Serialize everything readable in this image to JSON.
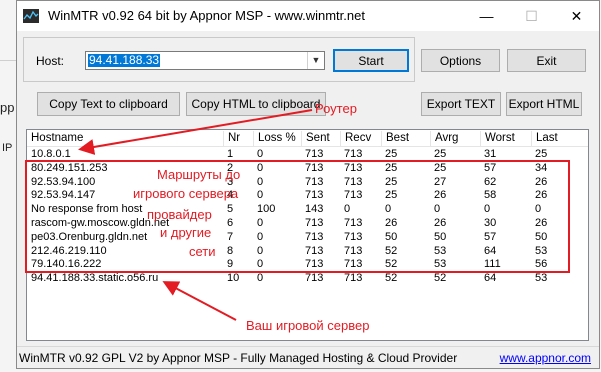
{
  "background": {
    "left_fragment": "pp",
    "ip_fragment": "IP"
  },
  "window": {
    "title": "WinMTR v0.92 64 bit by Appnor MSP - www.winmtr.net",
    "minimize": "—",
    "maximize": "☐",
    "close": "✕"
  },
  "host": {
    "label": "Host:",
    "value": "94.41.188.33"
  },
  "buttons": {
    "start": "Start",
    "options": "Options",
    "exit": "Exit",
    "copy_text": "Copy Text to clipboard",
    "copy_html": "Copy HTML to clipboard",
    "export_text": "Export TEXT",
    "export_html": "Export HTML"
  },
  "table": {
    "columns": [
      "Hostname",
      "Nr",
      "Loss %",
      "Sent",
      "Recv",
      "Best",
      "Avrg",
      "Worst",
      "Last"
    ],
    "rows": [
      [
        "10.8.0.1",
        "1",
        "0",
        "713",
        "713",
        "25",
        "25",
        "31",
        "25"
      ],
      [
        "80.249.151.253",
        "2",
        "0",
        "713",
        "713",
        "25",
        "25",
        "57",
        "34"
      ],
      [
        "92.53.94.100",
        "3",
        "0",
        "713",
        "713",
        "25",
        "27",
        "62",
        "26"
      ],
      [
        "92.53.94.147",
        "4",
        "0",
        "713",
        "713",
        "25",
        "26",
        "58",
        "26"
      ],
      [
        "No response from host",
        "5",
        "100",
        "143",
        "0",
        "0",
        "0",
        "0",
        "0"
      ],
      [
        "rascom-gw.moscow.gldn.net",
        "6",
        "0",
        "713",
        "713",
        "26",
        "26",
        "30",
        "26"
      ],
      [
        "pe03.Orenburg.gldn.net",
        "7",
        "0",
        "713",
        "713",
        "50",
        "50",
        "57",
        "50"
      ],
      [
        "212.46.219.110",
        "8",
        "0",
        "713",
        "713",
        "52",
        "53",
        "64",
        "53"
      ],
      [
        "79.140.16.222",
        "9",
        "0",
        "713",
        "713",
        "52",
        "53",
        "111",
        "56"
      ],
      [
        "94.41.188.33.static.o56.ru",
        "10",
        "0",
        "713",
        "713",
        "52",
        "52",
        "64",
        "53"
      ]
    ]
  },
  "status": {
    "text": "WinMTR v0.92 GPL V2 by Appnor MSP - Fully Managed Hosting & Cloud Provider",
    "link": "www.appnor.com"
  },
  "annotations": {
    "router": "Роутер",
    "routes_line1": "Маршруты до",
    "routes_line2": "игрового сервера",
    "routes_line3": "провайдер",
    "routes_line4": "и другие",
    "routes_line5": "сети",
    "server": "Ваш игровой сервер",
    "color": "#e31b23"
  }
}
